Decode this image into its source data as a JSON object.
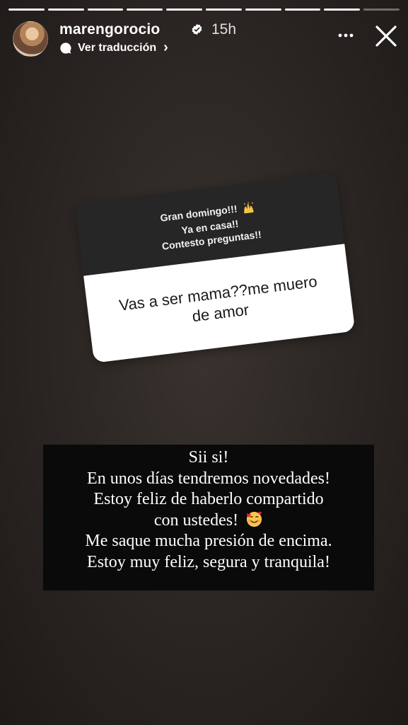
{
  "story": {
    "progress_total": 10,
    "progress_current": 9
  },
  "header": {
    "username": "marengorocio",
    "time": "15h",
    "translate_label": "Ver traducción"
  },
  "sticker": {
    "prompt_lines": [
      "Gran domingo!!!",
      "Ya en casa!!",
      "Contesto preguntas!!"
    ],
    "question_lines": [
      "Vas a ser mama??me muero",
      "de amor"
    ],
    "prompt_emoji": "raising-hands-emoji"
  },
  "caption": {
    "lines": [
      "Sii si!",
      "En unos días tendremos novedades!",
      "Estoy feliz de haberlo compartido",
      "con ustedes!",
      "Me saque mucha presión de encima.",
      "Estoy muy feliz, segura y tranquila!"
    ],
    "emoji": "smiling-face-with-hearts-emoji"
  },
  "colors": {
    "background": "#2a2522",
    "sticker_top": "#262626",
    "caption_bg": "#0a0a0a"
  }
}
